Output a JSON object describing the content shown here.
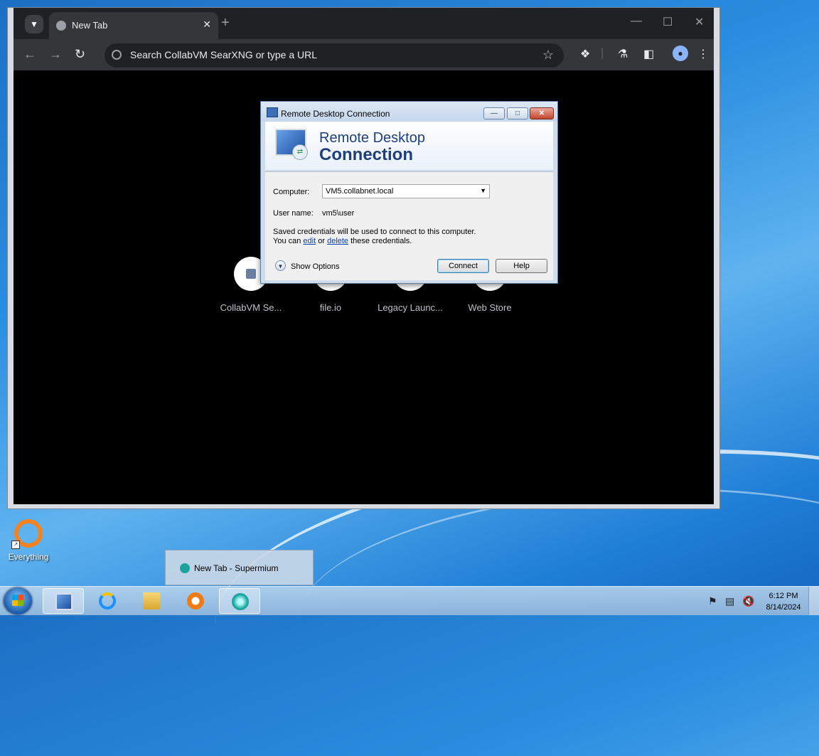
{
  "browser": {
    "tab_title": "New Tab",
    "omnibox_placeholder": "Search CollabVM SearXNG or type a URL",
    "shortcuts": [
      {
        "label": "CollabVM Se..."
      },
      {
        "label": "file.io"
      },
      {
        "label": "Legacy Launc..."
      },
      {
        "label": "Web Store"
      }
    ]
  },
  "rdp": {
    "window_title": "Remote Desktop Connection",
    "banner_line1": "Remote Desktop",
    "banner_line2": "Connection",
    "computer_label": "Computer:",
    "computer_value": "VM5.collabnet.local",
    "username_label": "User name:",
    "username_value": "vm5\\user",
    "cred_line1": "Saved credentials will be used to connect to this computer.",
    "cred_prefix": "You can",
    "cred_edit": "edit",
    "cred_or": "or",
    "cred_delete": "delete",
    "cred_suffix": "these credentials.",
    "show_options": "Show Options",
    "connect_label": "Connect",
    "help_label": "Help"
  },
  "desktop": {
    "icon_label": "Everything"
  },
  "taskbar": {
    "preview_title": "New Tab - Supermium",
    "time": "6:12 PM",
    "date": "8/14/2024"
  }
}
